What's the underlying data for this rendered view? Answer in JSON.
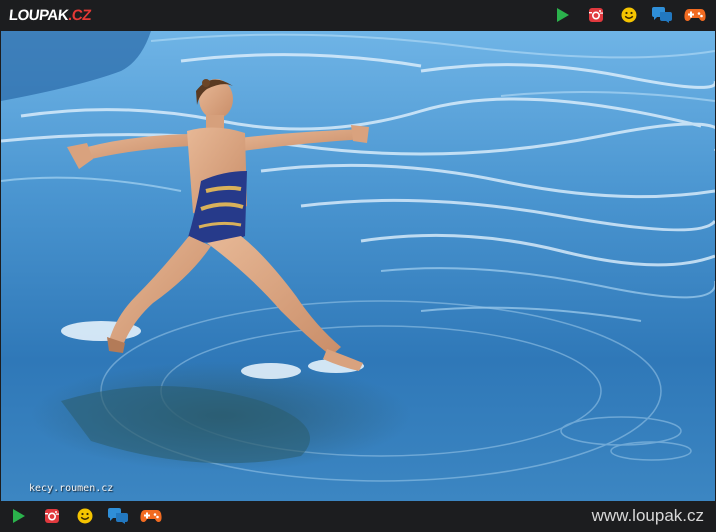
{
  "header": {
    "logo_main": "LOUPAK",
    "logo_suffix": ".CZ",
    "icons": [
      "play-icon",
      "instagram-icon",
      "smiley-icon",
      "chat-icon",
      "gamepad-icon"
    ]
  },
  "photo": {
    "watermark": "kecy.roumen.cz"
  },
  "footer": {
    "icons": [
      "play-icon",
      "instagram-icon",
      "smiley-icon",
      "chat-icon",
      "gamepad-icon"
    ],
    "site_url": "www.loupak.cz"
  },
  "colors": {
    "bar_background": "#1c1d1f",
    "play": "#2bb24c",
    "instagram": "#e0393e",
    "smiley": "#f5c400",
    "chat": "#2f8fd8",
    "gamepad": "#f26b21",
    "logo_accent": "#e53935",
    "water": "#3d88c4"
  }
}
